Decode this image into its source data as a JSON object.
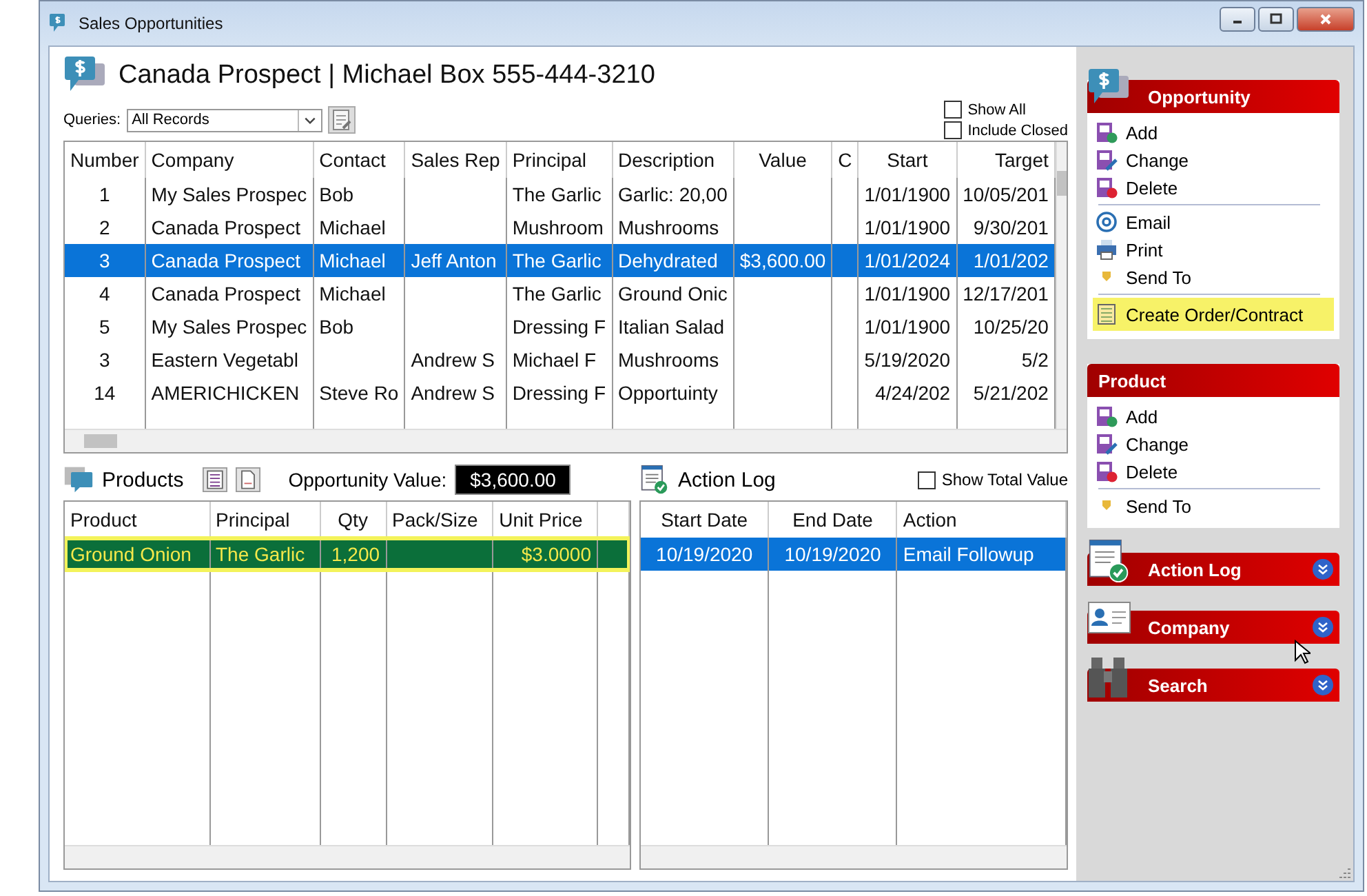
{
  "window": {
    "title": "Sales Opportunities"
  },
  "header": {
    "title": "Canada Prospect | Michael Box 555-444-3210"
  },
  "queries": {
    "label": "Queries:",
    "value": "All Records"
  },
  "filters": [
    {
      "label": "Show All",
      "checked": false
    },
    {
      "label": "Include Closed",
      "checked": false
    }
  ],
  "opportunities": {
    "columns": [
      "Number",
      "Company",
      "Contact",
      "Sales Rep",
      "Principal",
      "Description",
      "Value",
      "C",
      "Start",
      "Target"
    ],
    "rows": [
      {
        "selected": false,
        "cells": [
          "1",
          "My Sales Prospec",
          "Bob",
          null,
          "The Garlic",
          "Garlic: 20,00",
          null,
          null,
          "1/01/1900",
          "10/05/201"
        ]
      },
      {
        "selected": false,
        "cells": [
          "2",
          "Canada Prospect",
          "Michael",
          null,
          "Mushroom",
          "Mushrooms",
          null,
          null,
          "1/01/1900",
          "9/30/201"
        ]
      },
      {
        "selected": true,
        "cells": [
          "3",
          "Canada Prospect",
          "Michael",
          "Jeff Anton",
          "The Garlic",
          "Dehydrated",
          "$3,600.00",
          null,
          "1/01/2024",
          "1/01/202"
        ]
      },
      {
        "selected": false,
        "cells": [
          "4",
          "Canada Prospect",
          "Michael",
          null,
          "The Garlic",
          "Ground Onic",
          null,
          null,
          "1/01/1900",
          "12/17/201"
        ]
      },
      {
        "selected": false,
        "cells": [
          "5",
          "My Sales Prospec",
          "Bob",
          null,
          "Dressing F",
          "Italian Salad",
          null,
          null,
          "1/01/1900",
          "10/25/20"
        ]
      },
      {
        "selected": false,
        "cells": [
          "3",
          "Eastern Vegetabl",
          null,
          "Andrew S",
          "Michael F",
          "Mushrooms",
          null,
          null,
          "5/19/2020",
          "5/2"
        ]
      },
      {
        "selected": false,
        "cells": [
          "14",
          "AMERICHICKEN",
          "Steve Ro",
          "Andrew S",
          "Dressing F",
          "Opportuinty",
          null,
          null,
          "4/24/202",
          "5/21/202"
        ]
      }
    ]
  },
  "products": {
    "title": "Products",
    "value_label": "Opportunity Value:",
    "value": "$3,600.00",
    "columns": [
      "Product",
      "Principal",
      "Qty",
      "Pack/Size",
      "Unit Price"
    ],
    "rows": [
      {
        "selected": true,
        "highlighted": true,
        "cells": [
          "Ground Onion",
          "The Garlic",
          "1,200",
          null,
          "$3.0000"
        ]
      }
    ]
  },
  "action_log": {
    "title": "Action Log",
    "show_total": {
      "label": "Show Total Value",
      "checked": false
    },
    "columns": [
      "Start Date",
      "End Date",
      "Action"
    ],
    "rows": [
      {
        "selected": true,
        "cells": [
          "10/19/2020",
          "10/19/2020",
          "Email Followup"
        ]
      }
    ]
  },
  "sidebar": {
    "panels": [
      {
        "title": "Opportunity",
        "kind": "opportunity",
        "expanded": true,
        "items": [
          {
            "label": "Add",
            "kind": "add",
            "separator_before": false,
            "highlighted": false
          },
          {
            "label": "Change",
            "kind": "change",
            "separator_before": false,
            "highlighted": false
          },
          {
            "label": "Delete",
            "kind": "delete",
            "separator_before": false,
            "highlighted": false
          },
          {
            "label": "Email",
            "kind": "email",
            "separator_before": true,
            "highlighted": false
          },
          {
            "label": "Print",
            "kind": "print",
            "separator_before": false,
            "highlighted": false
          },
          {
            "label": "Send To",
            "kind": "send",
            "separator_before": false,
            "highlighted": false
          },
          {
            "label": "Create Order/Contract",
            "kind": "order",
            "separator_before": true,
            "highlighted": true
          }
        ]
      },
      {
        "title": "Product",
        "kind": "plain",
        "expanded": true,
        "items": [
          {
            "label": "Add",
            "kind": "add",
            "separator_before": false,
            "highlighted": false
          },
          {
            "label": "Change",
            "kind": "change",
            "separator_before": false,
            "highlighted": false
          },
          {
            "label": "Delete",
            "kind": "delete",
            "separator_before": false,
            "highlighted": false
          },
          {
            "label": "Send To",
            "kind": "send",
            "separator_before": true,
            "highlighted": false
          }
        ]
      },
      {
        "title": "Action Log",
        "kind": "action_log",
        "expanded": false
      },
      {
        "title": "Company",
        "kind": "company",
        "expanded": false
      },
      {
        "title": "Search",
        "kind": "search",
        "expanded": false
      }
    ]
  }
}
